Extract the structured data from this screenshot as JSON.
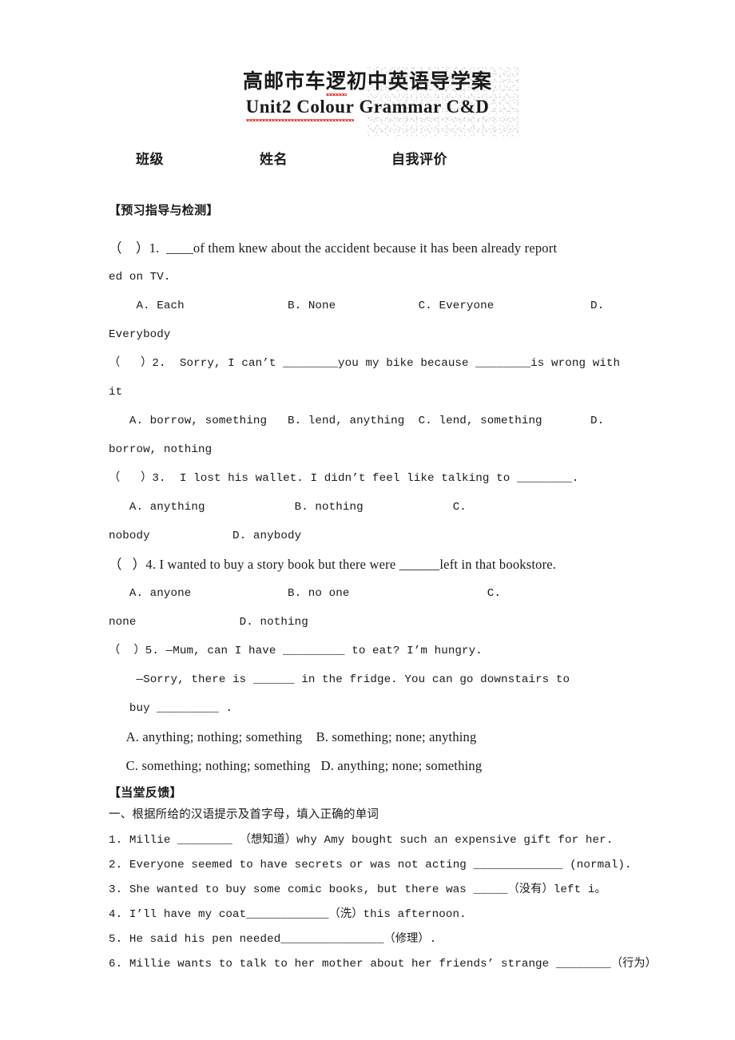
{
  "document": {
    "title_cn": "高邮市车逻初中英语导学案",
    "title_cn_plain_a": "高邮市车",
    "title_cn_squiggly": "逻",
    "title_cn_plain_b": "初中英语导学案",
    "title_en": "Unit2 Colour Grammar C&D",
    "title_en_squiggly": "Unit2 Colour",
    "title_en_plain": " Grammar C&D"
  },
  "info": {
    "class_label": "班级",
    "name_label": "姓名",
    "selfeval_label": "自我评价"
  },
  "sections": {
    "preview_heading": "【预习指导与检测】",
    "feedback_heading": "【当堂反馈】",
    "feedback_sub": "一、根据所给的汉语提示及首字母，填入正确的单词"
  },
  "choice_questions": [
    {
      "stem_lines": [
        "（    ）1.  ____of them knew about the accident because it has been already report",
        "ed on TV."
      ],
      "option_lines": [
        "    A. Each               B. None            C. Everyone              D.",
        "Everybody"
      ]
    },
    {
      "stem_lines": [
        "（   ）2.  Sorry, I can’t ________you my bike because ________is wrong with it"
      ],
      "option_lines": [
        "   A. borrow, something   B. lend, anything  C. lend, something       D.",
        "borrow, nothing"
      ]
    },
    {
      "stem_lines": [
        "（   ）3.  I lost his wallet. I didn’t feel like talking to ________."
      ],
      "option_lines": [
        "   A. anything             B. nothing             C.",
        "nobody            D. anybody"
      ]
    },
    {
      "stem_lines": [
        "（   ）4. I wanted to buy a story book but there were ______left in that bookstore."
      ],
      "option_lines": [
        "   A. anyone              B. no one                    C.",
        "none               D. nothing"
      ]
    },
    {
      "stem_lines": [
        "（  ）5. —Mum, can I have _________ to eat? I’m hungry.",
        "    —Sorry, there is ______ in the fridge. You can go downstairs to",
        "   buy _________ ."
      ],
      "option_lines": [
        "     A. anything; nothing; something    B. something; none; anything",
        "     C. something; nothing; something   D. anything; none; something"
      ]
    }
  ],
  "fill_items": [
    "1. Millie ________ （想知道）why Amy bought such an expensive gift for her.",
    "2. Everyone seemed to have secrets or was not acting _____________ (normal).",
    "3. She wanted to buy some comic books, but there was _____（没有）left i。",
    "4. I’ll have my coat____________（洗）this afternoon.",
    "5. He said his pen needed_______________（修理）.",
    "6. Millie wants to talk to her mother about her friends’ strange ________（行为）"
  ]
}
